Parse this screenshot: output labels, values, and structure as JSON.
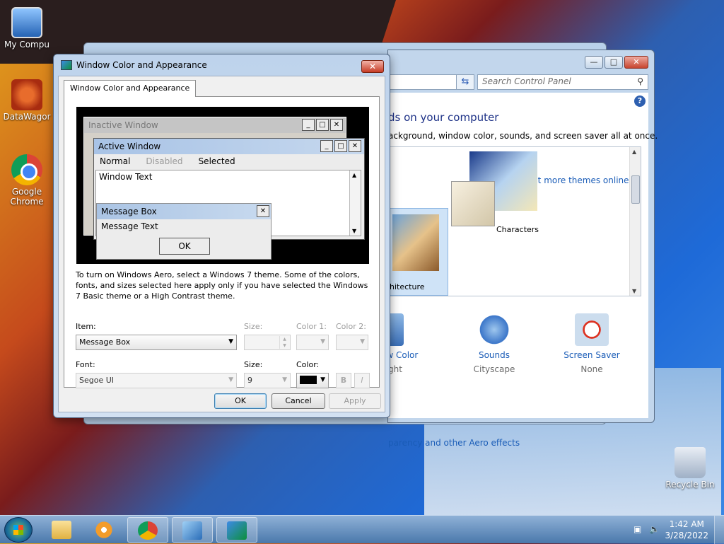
{
  "desktop": {
    "icons": [
      {
        "label": "My Compu",
        "icon": "computer-icon"
      },
      {
        "label": "DataWagor",
        "icon": "datawagon-icon"
      },
      {
        "label": "Google Chrome",
        "icon": "chrome-icon"
      },
      {
        "label": "Recycle Bin",
        "icon": "recycle-bin-icon"
      }
    ]
  },
  "control_panel": {
    "search_placeholder": "Search Control Panel",
    "heading": "ds on your computer",
    "description": "ackground, window color, sounds, and screen saver all at once.",
    "get_more_themes": "Get more themes online",
    "themes": [
      {
        "label": "hitecture"
      },
      {
        "label": "Characters"
      }
    ],
    "options": [
      {
        "title": "ow Color",
        "sub": "ilight",
        "icon": "window-color-icon"
      },
      {
        "title": "Sounds",
        "sub": "Cityscape",
        "icon": "sounds-icon"
      },
      {
        "title": "Screen Saver",
        "sub": "None",
        "icon": "screen-saver-icon"
      }
    ],
    "aero_link": "parency and other Aero effects"
  },
  "dialog": {
    "title": "Window Color and Appearance",
    "tab_label": "Window Color and Appearance",
    "preview": {
      "inactive_title": "Inactive Window",
      "active_title": "Active Window",
      "menu": {
        "normal": "Normal",
        "disabled": "Disabled",
        "selected": "Selected"
      },
      "window_text": "Window Text",
      "message_box_title": "Message Box",
      "message_text": "Message Text",
      "ok": "OK"
    },
    "info": "To turn on Windows Aero, select a Windows 7 theme.  Some of the colors, fonts, and sizes selected here apply only if you have selected the Windows 7 Basic theme or a High Contrast theme.",
    "item_label": "Item:",
    "item_value": "Message Box",
    "size_label": "Size:",
    "color1_label": "Color 1:",
    "color2_label": "Color 2:",
    "font_label": "Font:",
    "font_value": "Segoe UI",
    "font_size_label": "Size:",
    "font_size_value": "9",
    "font_color_label": "Color:",
    "font_color": "#000000",
    "bold_label": "B",
    "italic_label": "I",
    "ok_button": "OK",
    "cancel_button": "Cancel",
    "apply_button": "Apply"
  },
  "taskbar": {
    "items": [
      "folder-icon",
      "media-player-icon",
      "chrome-icon",
      "control-panel-icon",
      "display-settings-icon"
    ],
    "time": "1:42 AM",
    "date": "3/28/2022"
  }
}
